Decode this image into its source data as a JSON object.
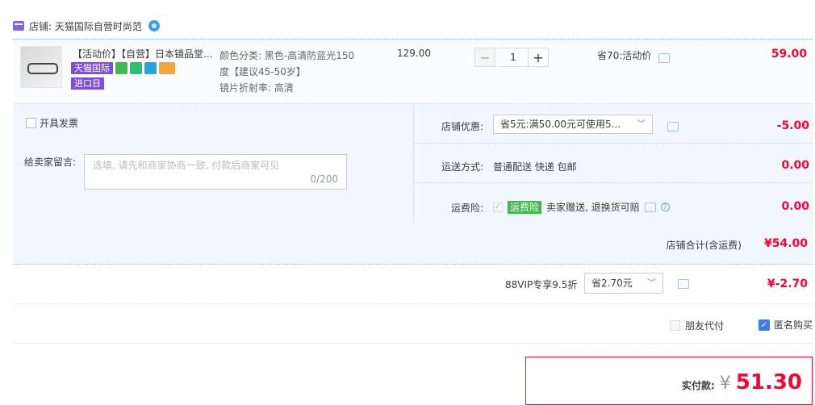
{
  "shop": {
    "label": "店铺: 天猫国际自营时尚范"
  },
  "item": {
    "title": "【活动价】【自营】日本镜品堂...",
    "tag_tmall": "天猫国际",
    "tag_import": "进口日",
    "sku_line1": "颜色分类: 黑色-高清防蓝光150",
    "sku_line2": "度【建议45-50岁】",
    "sku_line3": "镜片折射率: 高清",
    "unit_price": "129.00",
    "quantity": "1",
    "minus": "−",
    "plus": "+",
    "save_note": "省70:活动价",
    "subtotal": "59.00"
  },
  "invoice": {
    "label": "开具发票"
  },
  "message": {
    "label": "给卖家留言:",
    "placeholder": "选填, 请先和商家协商一致, 付款后商家可见",
    "counter": "0/200"
  },
  "shop_discount": {
    "label": "店铺优惠:",
    "selected": "省5元:满50.00元可使用5...",
    "amount": "-5.00"
  },
  "shipping": {
    "label": "运送方式:",
    "method": "普通配送 快递 包邮",
    "amount": "0.00"
  },
  "insurance": {
    "label": "运费险:",
    "tag": "运费险",
    "desc": "卖家赠送, 退换货可赔",
    "amount": "0.00"
  },
  "shop_total": {
    "label": "店铺合计(含运费)",
    "amount": "¥54.00"
  },
  "vip": {
    "label": "88VIP专享9.5折",
    "selected": "省2.70元",
    "amount": "¥-2.70"
  },
  "options": {
    "friend_pay": "朋友代付",
    "anonymous": "匿名购买"
  },
  "payment": {
    "label": "实付款:",
    "currency": "¥",
    "amount": "51.30"
  },
  "colors": {
    "accent_red": "#ff0036",
    "tag_purple": "#7f4ed9",
    "checkbox_blue": "#3a7cf0"
  }
}
